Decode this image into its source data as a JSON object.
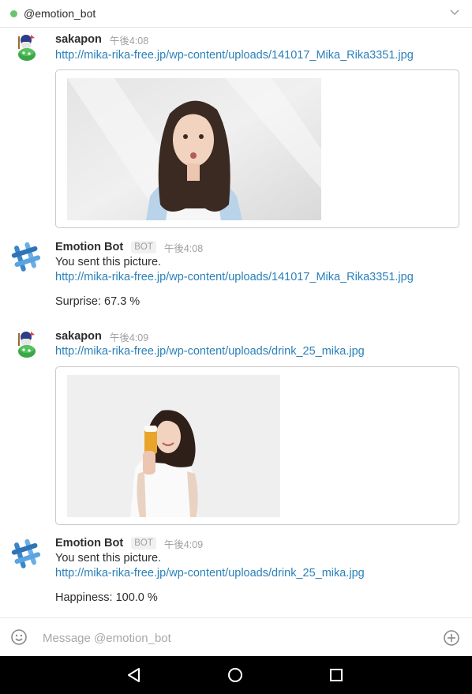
{
  "header": {
    "channel": "@emotion_bot",
    "presence_color": "#6cc36e",
    "chevron_icon": "chevron-down-icon"
  },
  "messages": [
    {
      "author": "sakapon",
      "time": "午後4:08",
      "link": "http://mika-rika-free.jp/wp-content/uploads/141017_Mika_Rika3351.jpg",
      "has_preview": true
    },
    {
      "author": "Emotion Bot",
      "badge": "BOT",
      "time": "午後4:08",
      "text": "You sent this picture.",
      "link": "http://mika-rika-free.jp/wp-content/uploads/141017_Mika_Rika3351.jpg",
      "result": "Surprise: 67.3 %"
    },
    {
      "author": "sakapon",
      "time": "午後4:09",
      "link": "http://mika-rika-free.jp/wp-content/uploads/drink_25_mika.jpg",
      "has_preview": true
    },
    {
      "author": "Emotion Bot",
      "badge": "BOT",
      "time": "午後4:09",
      "text": "You sent this picture.",
      "link": "http://mika-rika-free.jp/wp-content/uploads/drink_25_mika.jpg",
      "result": "Happiness: 100.0 %"
    }
  ],
  "composer": {
    "placeholder": "Message @emotion_bot",
    "emoji_icon": "smiley-icon",
    "attach_icon": "plus-circle-icon"
  },
  "navbar": {
    "icons": [
      "back-triangle-icon",
      "home-circle-icon",
      "recents-square-icon"
    ]
  },
  "colors": {
    "link": "#2a80b9",
    "text": "#2c2d30",
    "muted": "#a0a0a2"
  }
}
